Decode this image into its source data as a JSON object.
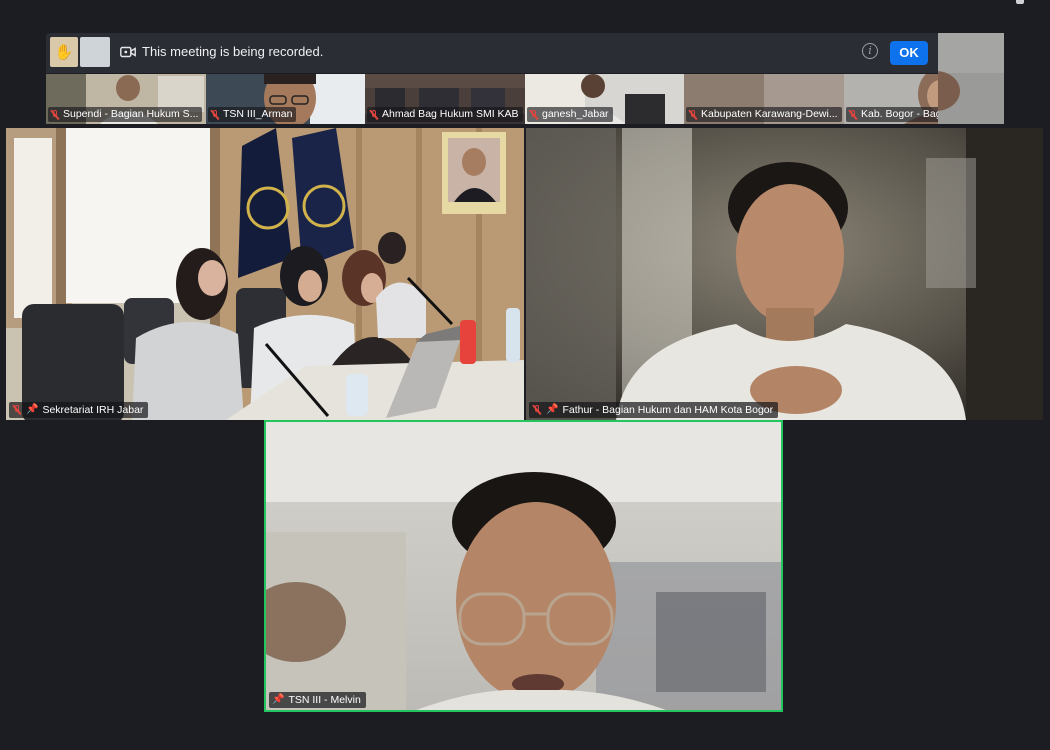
{
  "banner": {
    "text": "This meeting is being recorded.",
    "ok_label": "OK",
    "info_symbol": "i",
    "raised_hand_symbol": "✋"
  },
  "thumbnails": [
    {
      "name": "Supendi - Bagian Hukum S..."
    },
    {
      "name": "TSN III_Arman"
    },
    {
      "name": "Ahmad Bag Hukum SMI KAB"
    },
    {
      "name": "ganesh_Jabar"
    },
    {
      "name": "Kabupaten Karawang-Dewi..."
    },
    {
      "name": "Kab. Bogor - Bagian Perun..."
    }
  ],
  "tiles": [
    {
      "name": "Sekretariat IRH Jabar"
    },
    {
      "name": "Fathur - Bagian Hukum dan HAM Kota Bogor"
    },
    {
      "name": "TSN III - Melvin"
    }
  ],
  "colors": {
    "background": "#1b1d23",
    "ok_button": "#0e72ed",
    "active_speaker_border": "#22c55e",
    "muted_mic": "#e0443e"
  },
  "icons": {
    "pin": "📌"
  }
}
